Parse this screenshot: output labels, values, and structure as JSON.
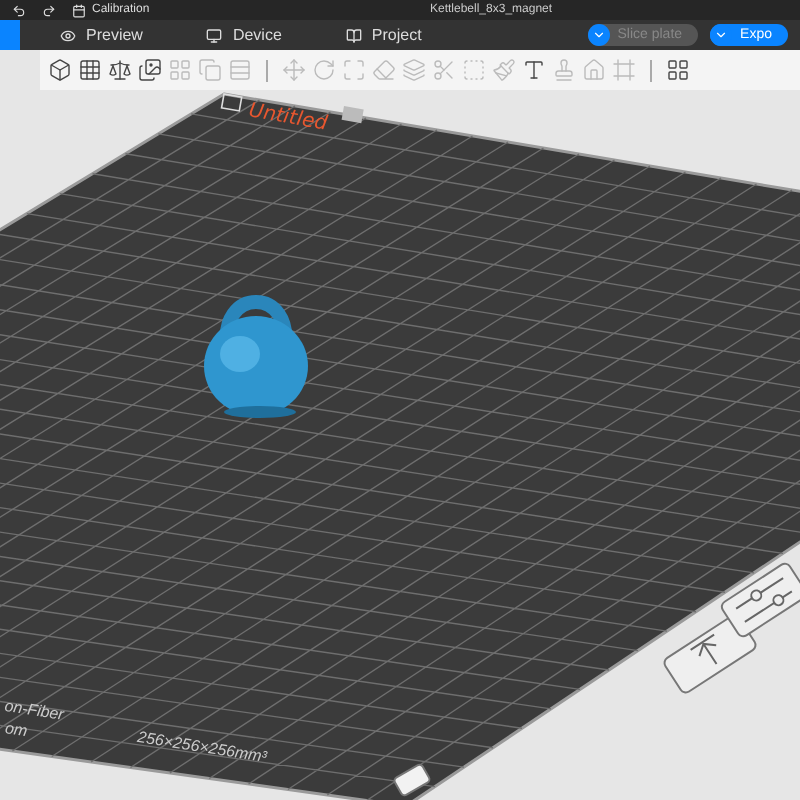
{
  "title_bar": {
    "menu_items": [
      "Calibration"
    ],
    "title": "Kettlebell_8x3_magnet"
  },
  "tabs": [
    {
      "label": "Preview",
      "selected": false
    },
    {
      "label": "Device",
      "selected": false
    },
    {
      "label": "Project",
      "selected": false
    }
  ],
  "actions": [
    {
      "label": "Slice plate",
      "disabled": true
    },
    {
      "label": "Expo",
      "disabled": false
    }
  ],
  "plate": {
    "name": "Untitled",
    "filament": "on-Fiber",
    "line_2": "om",
    "size": "256×256×256mm³"
  }
}
